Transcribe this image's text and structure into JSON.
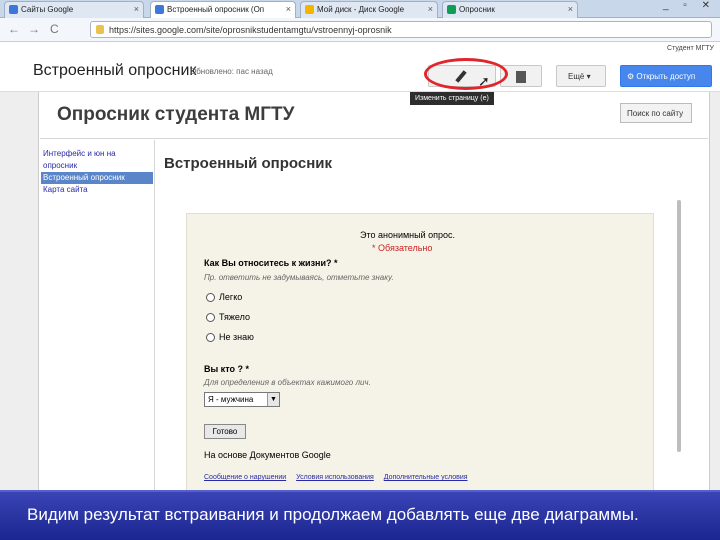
{
  "browser": {
    "tabs": [
      {
        "label": "Сайты Google",
        "active": false
      },
      {
        "label": "Встроенный опросник (Оп",
        "active": true
      },
      {
        "label": "Мой диск - Диск Google",
        "active": false
      },
      {
        "label": "Опросник",
        "active": false
      }
    ],
    "window_controls": "_ ▫ ✕",
    "nav": {
      "back": "←",
      "forward": "→",
      "reload": "C"
    },
    "url": "https://sites.google.com/site/oprosnikstudentamgtu/vstroennyj-oprosnik"
  },
  "sites_header": {
    "user": "Студент МГТУ",
    "page_name": "Встроенный опросник",
    "saved_status": "Обновлено: пас назад",
    "more_label": "Ещё ▾",
    "share_label": "Открыть доступ",
    "tooltip": "Изменить страницу (e)"
  },
  "site": {
    "title": "Опросник студента МГТУ",
    "search_button": "Поиск по сайту",
    "sidebar": [
      {
        "label": "Интерфейс и юн на",
        "active": false
      },
      {
        "label": "опросник",
        "active": false
      },
      {
        "label": "Встроенный опросник",
        "active": true
      },
      {
        "label": "Карта сайта",
        "active": false
      }
    ],
    "content_title": "Встроенный опросник"
  },
  "form": {
    "anonymous_note": "Это анонимный опрос.",
    "required_note": "* Обязательно",
    "question1": "Как Вы относитесь к жизни? *",
    "hint1": "Пр. ответить не задумываясь, отметьте знаку.",
    "options1": [
      "Легко",
      "Тяжело",
      "Не знаю"
    ],
    "question2": "Вы кто ? *",
    "hint2": "Для определения в объектах кажимого лич.",
    "select_value": "Я - мужчина",
    "submit_label": "Готово",
    "powered_by": "На основе Документов Google",
    "footer_links": [
      "Сообщение о нарушении",
      "Условия использования",
      "Дополнительные условия"
    ]
  },
  "caption": "Видим результат встраивания и продолжаем добавлять еще две диаграммы.",
  "colors": {
    "highlight_circle": "#e0262c",
    "share_button": "#4787ed",
    "caption_bg": "#2a34a5"
  }
}
